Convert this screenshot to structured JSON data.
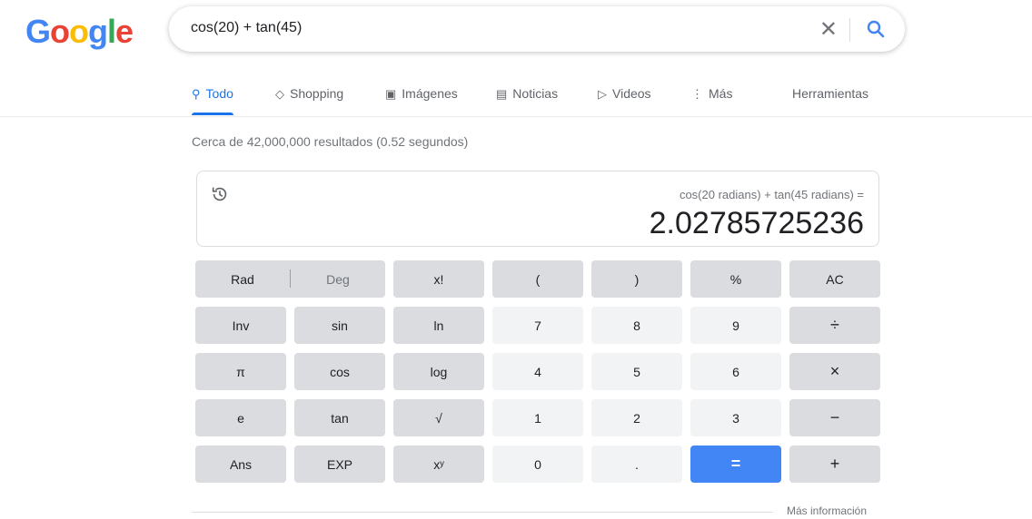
{
  "logo": {
    "letters": [
      {
        "ch": "G",
        "color": "#4285f4"
      },
      {
        "ch": "o",
        "color": "#ea4335"
      },
      {
        "ch": "o",
        "color": "#fbbc05"
      },
      {
        "ch": "g",
        "color": "#4285f4"
      },
      {
        "ch": "l",
        "color": "#34a853"
      },
      {
        "ch": "e",
        "color": "#ea4335"
      }
    ]
  },
  "search": {
    "query": "cos(20) + tan(45)",
    "clear_icon": "close-icon",
    "search_icon": "search-icon"
  },
  "tabs": [
    {
      "label": "Todo",
      "icon": "search-icon",
      "glyph": "⚲",
      "active": true
    },
    {
      "label": "Shopping",
      "icon": "tag-icon",
      "glyph": "◇",
      "active": false
    },
    {
      "label": "Imágenes",
      "icon": "image-icon",
      "glyph": "▣",
      "active": false
    },
    {
      "label": "Noticias",
      "icon": "news-icon",
      "glyph": "▤",
      "active": false
    },
    {
      "label": "Videos",
      "icon": "play-icon",
      "glyph": "▷",
      "active": false
    },
    {
      "label": "Más",
      "icon": "more-vert-icon",
      "glyph": "⋮",
      "active": false
    }
  ],
  "tools_label": "Herramientas",
  "stats": "Cerca de 42,000,000 resultados (0.52 segundos)",
  "calculator": {
    "expression": "cos(20 radians) + tan(45 radians) =",
    "result": "2.02785725236",
    "history_icon": "history-icon",
    "rad_label": "Rad",
    "deg_label": "Deg",
    "keys": [
      [
        "x!",
        "(",
        ")",
        "%",
        "AC"
      ],
      [
        "Inv",
        "sin",
        "ln",
        "7",
        "8",
        "9",
        "÷"
      ],
      [
        "π",
        "cos",
        "log",
        "4",
        "5",
        "6",
        "×"
      ],
      [
        "e",
        "tan",
        "√",
        "1",
        "2",
        "3",
        "−"
      ],
      [
        "Ans",
        "EXP",
        "xʸ",
        "0",
        ".",
        "=",
        "+"
      ]
    ]
  },
  "more_info": "Más información",
  "colors": {
    "accent": "#1a73e8",
    "equals": "#4285f4",
    "key_dark": "#dadce0",
    "key_light": "#f1f3f4"
  }
}
